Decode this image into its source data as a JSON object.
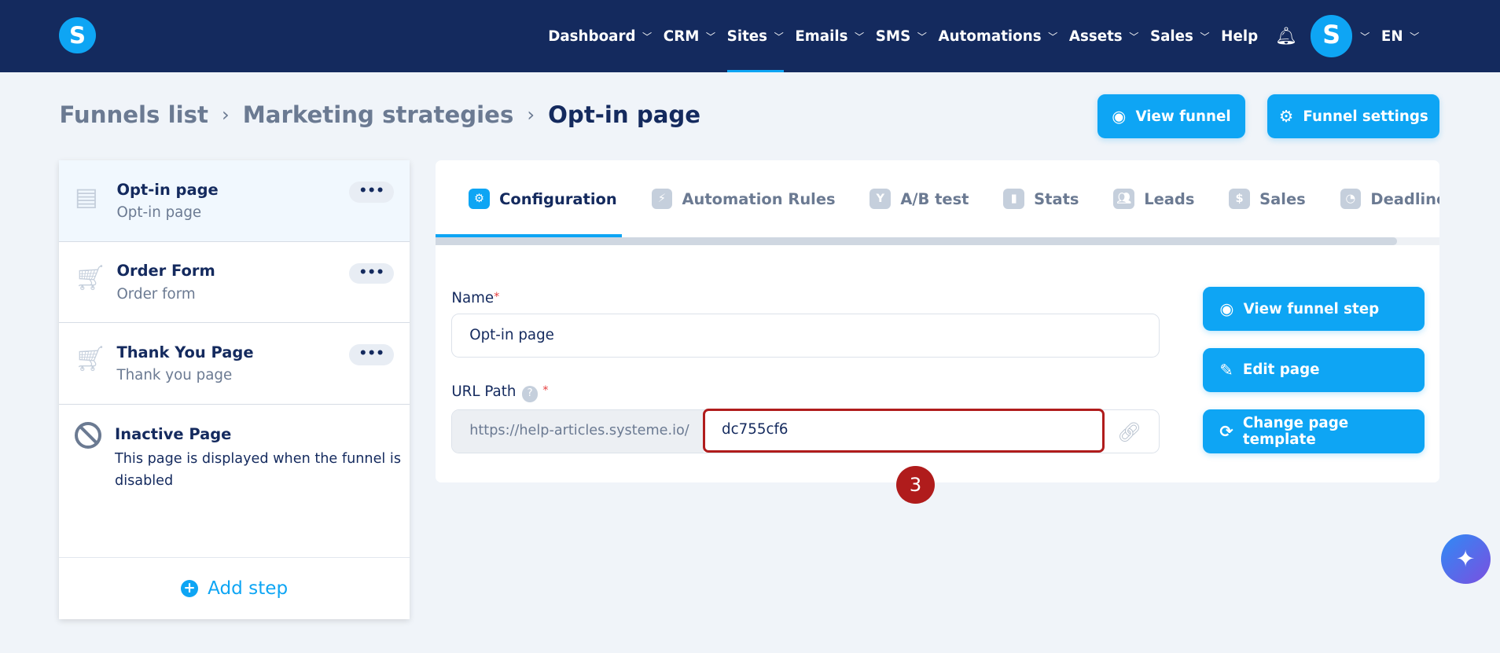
{
  "header": {
    "logo": "S",
    "nav": [
      {
        "label": "Dashboard",
        "dd": true
      },
      {
        "label": "CRM",
        "dd": true
      },
      {
        "label": "Sites",
        "dd": true,
        "active": true
      },
      {
        "label": "Emails",
        "dd": true
      },
      {
        "label": "SMS",
        "dd": true
      },
      {
        "label": "Automations",
        "dd": true
      },
      {
        "label": "Assets",
        "dd": true
      },
      {
        "label": "Sales",
        "dd": true
      },
      {
        "label": "Help",
        "dd": false
      }
    ],
    "avatar": "S",
    "lang": "EN"
  },
  "breadcrumb": {
    "items": [
      "Funnels list",
      "Marketing strategies"
    ],
    "current": "Opt-in page"
  },
  "actions": {
    "view_funnel": "View funnel",
    "funnel_settings": "Funnel settings"
  },
  "steps": [
    {
      "title": "Opt-in page",
      "subtitle": "Opt-in page",
      "icon": "page-icon"
    },
    {
      "title": "Order Form",
      "subtitle": "Order form",
      "icon": "cart-icon"
    },
    {
      "title": "Thank You Page",
      "subtitle": "Thank you page",
      "icon": "cart-check-icon"
    }
  ],
  "inactive": {
    "title": "Inactive Page",
    "description": "This page is displayed when the funnel is disabled"
  },
  "add_step": "Add step",
  "tabs": [
    "Configuration",
    "Automation Rules",
    "A/B test",
    "Stats",
    "Leads",
    "Sales",
    "Deadline settings"
  ],
  "form": {
    "name_label": "Name",
    "name_value": "Opt-in page",
    "url_label": "URL Path",
    "url_prefix": "https://help-articles.systeme.io/",
    "url_slug": "dc755cf6",
    "required": "*",
    "help": "?"
  },
  "side_buttons": {
    "view_step": "View funnel step",
    "edit_page": "Edit page",
    "change_template": "Change page template"
  },
  "annotation": "3",
  "colors": {
    "header": "#142a5e",
    "accent": "#0ea5f4",
    "annotation": "#b01c1c"
  }
}
